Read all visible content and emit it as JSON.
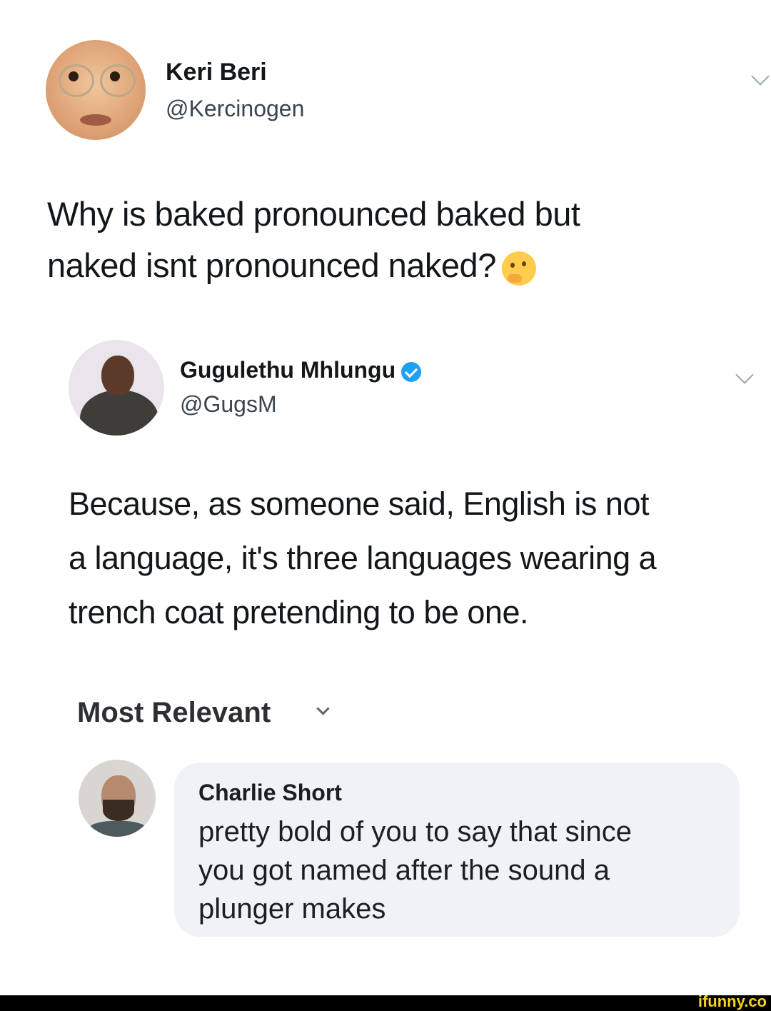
{
  "tweet1": {
    "name": "Keri Beri",
    "handle": "@Kercinogen",
    "text_line1": "Why is baked pronounced baked but",
    "text_line2": "naked isnt pronounced naked?",
    "emoji_icon": "thinking-face-icon"
  },
  "tweet2": {
    "name": "Gugulethu Mhlungu",
    "handle": "@GugsM",
    "verified": true,
    "text_line1": "Because, as someone said, English is not",
    "text_line2": "a language, it's three languages wearing a",
    "text_line3": "trench coat pretending to be one."
  },
  "comments": {
    "sort_label": "Most Relevant",
    "items": [
      {
        "name": "Charlie Short",
        "line1": "pretty bold of you to say that since",
        "line2": "you got named after the sound a",
        "line3": "plunger makes"
      }
    ]
  },
  "watermark": "ifunny.co",
  "colors": {
    "verified_blue": "#1da1f2",
    "bubble_bg": "#f0f2f5",
    "watermark_yellow": "#f5d21f"
  }
}
